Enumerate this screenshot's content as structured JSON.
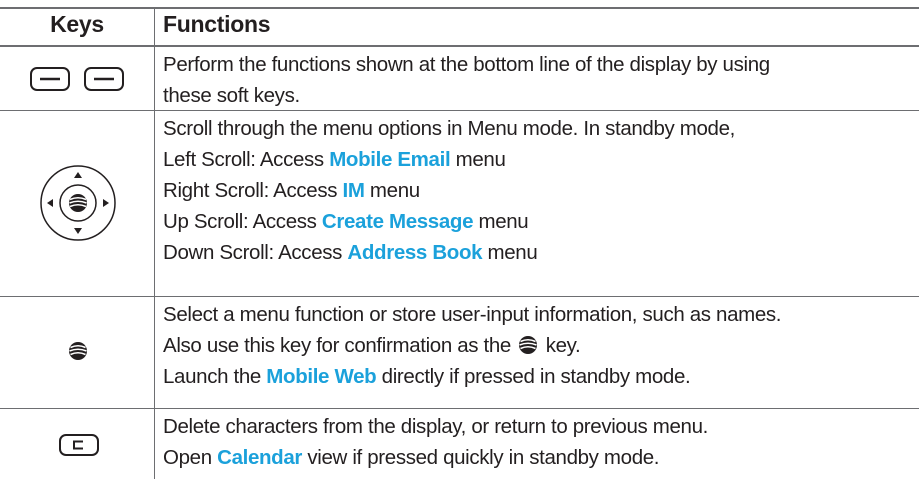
{
  "header": {
    "keys": "Keys",
    "functions": "Functions"
  },
  "rows": [
    {
      "icon": "soft-keys-icon",
      "lines": [
        [
          {
            "t": "Perform the functions shown at the bottom line of the display by using"
          }
        ],
        [
          {
            "t": "these soft keys."
          }
        ]
      ]
    },
    {
      "icon": "navigation-key-icon",
      "lines": [
        [
          {
            "t": "Scroll through the menu options in Menu mode. In standby mode,"
          }
        ],
        [
          {
            "t": "Left Scroll: Access "
          },
          {
            "t": "Mobile Email",
            "h": true
          },
          {
            "t": " menu"
          }
        ],
        [
          {
            "t": "Right Scroll: Access "
          },
          {
            "t": "IM",
            "h": true
          },
          {
            "t": " menu"
          }
        ],
        [
          {
            "t": "Up Scroll: Access "
          },
          {
            "t": "Create Message",
            "h": true
          },
          {
            "t": " menu"
          }
        ],
        [
          {
            "t": "Down Scroll: Access "
          },
          {
            "t": "Address Book",
            "h": true
          },
          {
            "t": " menu"
          }
        ]
      ]
    },
    {
      "icon": "att-globe-icon",
      "lines": [
        [
          {
            "t": "Select a menu function or store user-input information, such as names."
          }
        ],
        [
          {
            "t": "Also use this key for confirmation as the "
          },
          {
            "icon": "att-globe-icon"
          },
          {
            "t": " key."
          }
        ],
        [
          {
            "t": "Launch the "
          },
          {
            "t": "Mobile Web",
            "h": true
          },
          {
            "t": " directly if pressed in standby mode."
          }
        ]
      ]
    },
    {
      "icon": "clear-key-icon",
      "lines": [
        [
          {
            "t": "Delete characters from the display, or return to previous menu."
          }
        ],
        [
          {
            "t": "Open "
          },
          {
            "t": "Calendar",
            "h": true
          },
          {
            "t": " view if pressed quickly in standby mode."
          }
        ]
      ]
    }
  ],
  "colors": {
    "text": "#231f20",
    "highlight": "#1ba1db",
    "rule": "#6d6e71"
  }
}
